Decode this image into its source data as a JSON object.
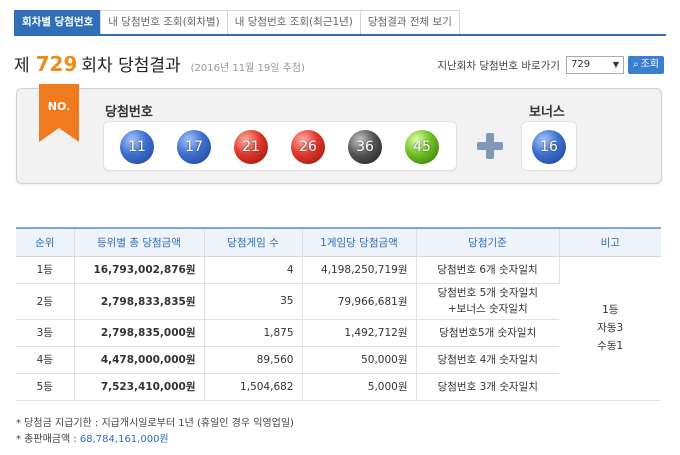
{
  "tabs": [
    {
      "label": "회차별 당첨번호",
      "active": true
    },
    {
      "label": "내 당첨번호 조회(회차별)",
      "active": false
    },
    {
      "label": "내 당첨번호 조회(최근1년)",
      "active": false
    },
    {
      "label": "당첨결과 전체 보기",
      "active": false
    }
  ],
  "header": {
    "prefix": "제",
    "round": "729",
    "suffix": "회차 당첨결과",
    "date": "(2016년 11월 19일 추첨)"
  },
  "goto": {
    "label": "지난회차 당첨번호 바로가기",
    "selected": "729",
    "button": "조회"
  },
  "badge": "NO.",
  "numbers_label": "당첨번호",
  "bonus_label": "보너스",
  "numbers": [
    {
      "value": "11",
      "color": "#3d6fcf"
    },
    {
      "value": "17",
      "color": "#3d6fcf"
    },
    {
      "value": "21",
      "color": "#e0372a"
    },
    {
      "value": "26",
      "color": "#e0372a"
    },
    {
      "value": "36",
      "color": "#555555"
    },
    {
      "value": "45",
      "color": "#6cc11f"
    }
  ],
  "bonus": {
    "value": "16",
    "color": "#3d6fcf"
  },
  "table": {
    "headers": [
      "순위",
      "등위별 총 당첨금액",
      "당첨게임 수",
      "1게임당 당첨금액",
      "당첨기준",
      "비고"
    ],
    "rows": [
      {
        "rank": "1등",
        "total": "16,793,002,876원",
        "count": "4",
        "each": "4,198,250,719원",
        "crit": "당첨번호 6개 숫자일치",
        "crit2": ""
      },
      {
        "rank": "2등",
        "total": "2,798,833,835원",
        "count": "35",
        "each": "79,966,681원",
        "crit": "당첨번호 5개 숫자일치",
        "crit2": "+보너스 숫자일치"
      },
      {
        "rank": "3등",
        "total": "2,798,835,000원",
        "count": "1,875",
        "each": "1,492,712원",
        "crit": "당첨번호5개 숫자일치",
        "crit2": ""
      },
      {
        "rank": "4등",
        "total": "4,478,000,000원",
        "count": "89,560",
        "each": "50,000원",
        "crit": "당첨번호 4개 숫자일치",
        "crit2": ""
      },
      {
        "rank": "5등",
        "total": "7,523,410,000원",
        "count": "1,504,682",
        "each": "5,000원",
        "crit": "당첨번호 3개 숫자일치",
        "crit2": ""
      }
    ],
    "note_lines": [
      "1등",
      "자동3",
      "수동1"
    ]
  },
  "notes": {
    "deadline": "* 당첨금 지급기한 : 지급개시일로부터 1년 (휴일인 경우 익영업일)",
    "sales_label": "* 총판매금액 : ",
    "sales_value": "68,784,161,000원"
  }
}
